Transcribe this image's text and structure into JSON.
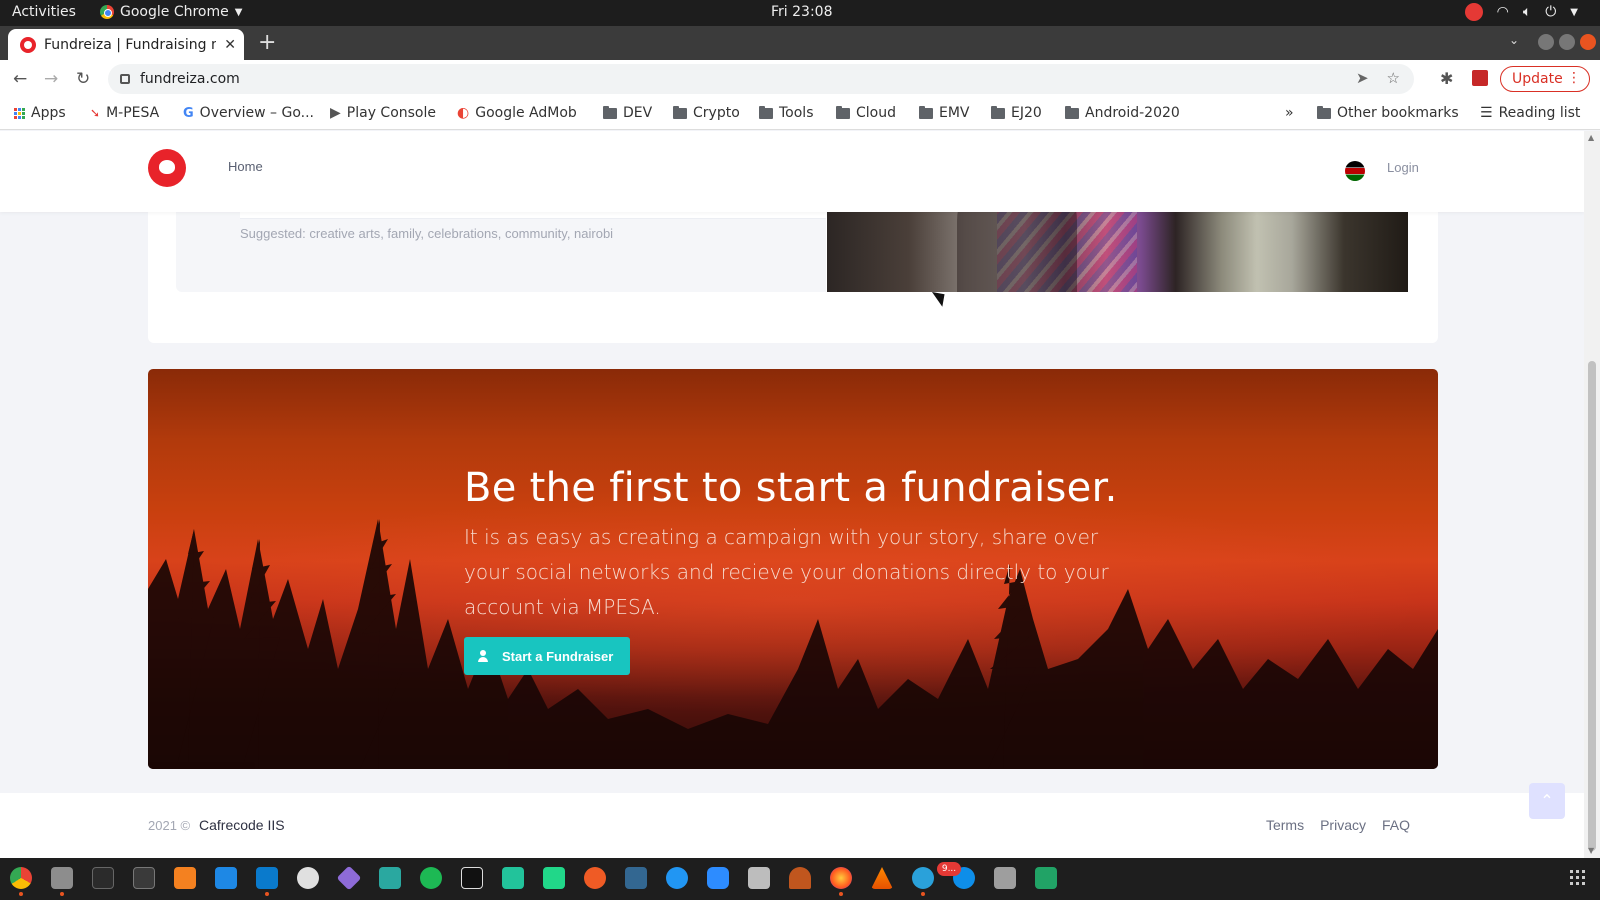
{
  "system": {
    "activities": "Activities",
    "app_name": "Google Chrome",
    "clock": "Fri 23:08",
    "tray_icons": [
      "notification-icon",
      "wifi-icon",
      "volume-icon",
      "power-icon"
    ]
  },
  "browser": {
    "tab_title": "Fundreiza | Fundraising m",
    "url": "fundreiza.com",
    "update_label": "Update",
    "bookmarks": [
      {
        "label": "Apps",
        "icon": "apps-grid-icon"
      },
      {
        "label": "M-PESA",
        "icon": "mpesa-icon"
      },
      {
        "label": "Overview – Go...",
        "icon": "google-icon"
      },
      {
        "label": "Play Console",
        "icon": "play-icon"
      },
      {
        "label": "Google AdMob",
        "icon": "admob-icon"
      },
      {
        "label": "DEV",
        "icon": "folder-icon"
      },
      {
        "label": "Crypto",
        "icon": "folder-icon"
      },
      {
        "label": "Tools",
        "icon": "folder-icon"
      },
      {
        "label": "Cloud",
        "icon": "folder-icon"
      },
      {
        "label": "EMV",
        "icon": "folder-icon"
      },
      {
        "label": "EJ20",
        "icon": "folder-icon"
      },
      {
        "label": "Android-2020",
        "icon": "folder-icon"
      }
    ],
    "more_bookmarks": "»",
    "other_bookmarks": "Other bookmarks",
    "reading_list": "Reading list"
  },
  "site": {
    "nav": {
      "home": "Home",
      "login": "Login"
    },
    "suggested": "Suggested: creative arts, family, celebrations, community, nairobi",
    "hero": {
      "title": "Be the first to start a fundraiser.",
      "body": "It is as easy as creating a campaign with your story, share over your social networks and recieve your donations directly to your account via MPESA.",
      "cta": "Start a Fundraiser"
    },
    "footer": {
      "year": "2021 ©",
      "company": "Cafrecode IIS",
      "links": [
        "Terms",
        "Privacy",
        "FAQ"
      ]
    }
  },
  "taskbar": {
    "apps": [
      "chrome",
      "files",
      "terminal",
      "system-monitor",
      "sublime-text",
      "remote-desktop",
      "vscode",
      "writer",
      "obsidian",
      "code-tool",
      "spotify",
      "intellij",
      "datagrip",
      "pycharm",
      "postman",
      "postgres",
      "browser",
      "zoom",
      "camera",
      "sun-app",
      "firefox",
      "vlc",
      "telegram",
      "teamviewer",
      "calculator",
      "sheets"
    ],
    "telegram_badge": "9..."
  },
  "colors": {
    "brand_red": "#e8232a",
    "cta_teal": "#18c5c0",
    "update_red": "#d93025"
  }
}
